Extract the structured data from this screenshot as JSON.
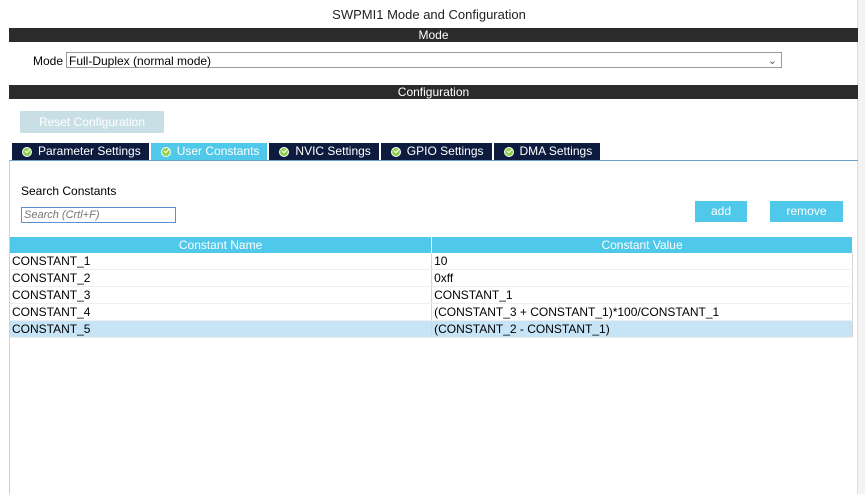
{
  "window": {
    "title": "SWPMI1 Mode and Configuration"
  },
  "mode_section": {
    "header": "Mode",
    "mode_label": "Mode",
    "mode_value": "Full-Duplex (normal mode)"
  },
  "config_section": {
    "header": "Configuration",
    "reset_label": "Reset Configuration",
    "tabs": [
      {
        "label": "Parameter Settings",
        "active": false
      },
      {
        "label": "User Constants",
        "active": true
      },
      {
        "label": "NVIC Settings",
        "active": false
      },
      {
        "label": "GPIO Settings",
        "active": false
      },
      {
        "label": "DMA Settings",
        "active": false
      }
    ]
  },
  "constants": {
    "search_label": "Search Constants",
    "search_placeholder": "Search (Crtl+F)",
    "add_label": "add",
    "remove_label": "remove",
    "columns": [
      "Constant Name",
      "Constant Value"
    ],
    "rows": [
      {
        "name": "CONSTANT_1",
        "value": "10"
      },
      {
        "name": "CONSTANT_2",
        "value": "0xff"
      },
      {
        "name": "CONSTANT_3",
        "value": "CONSTANT_1"
      },
      {
        "name": "CONSTANT_4",
        "value": "(CONSTANT_3 + CONSTANT_1)*100/CONSTANT_1"
      },
      {
        "name": "CONSTANT_5",
        "value": "(CONSTANT_2 - CONSTANT_1)"
      }
    ],
    "selected_row": 4
  },
  "colors": {
    "accent": "#4fc8ea",
    "tab_dark": "#0d1b3e",
    "header_bar": "#2b2b2b",
    "selection": "#c6e4f5"
  }
}
